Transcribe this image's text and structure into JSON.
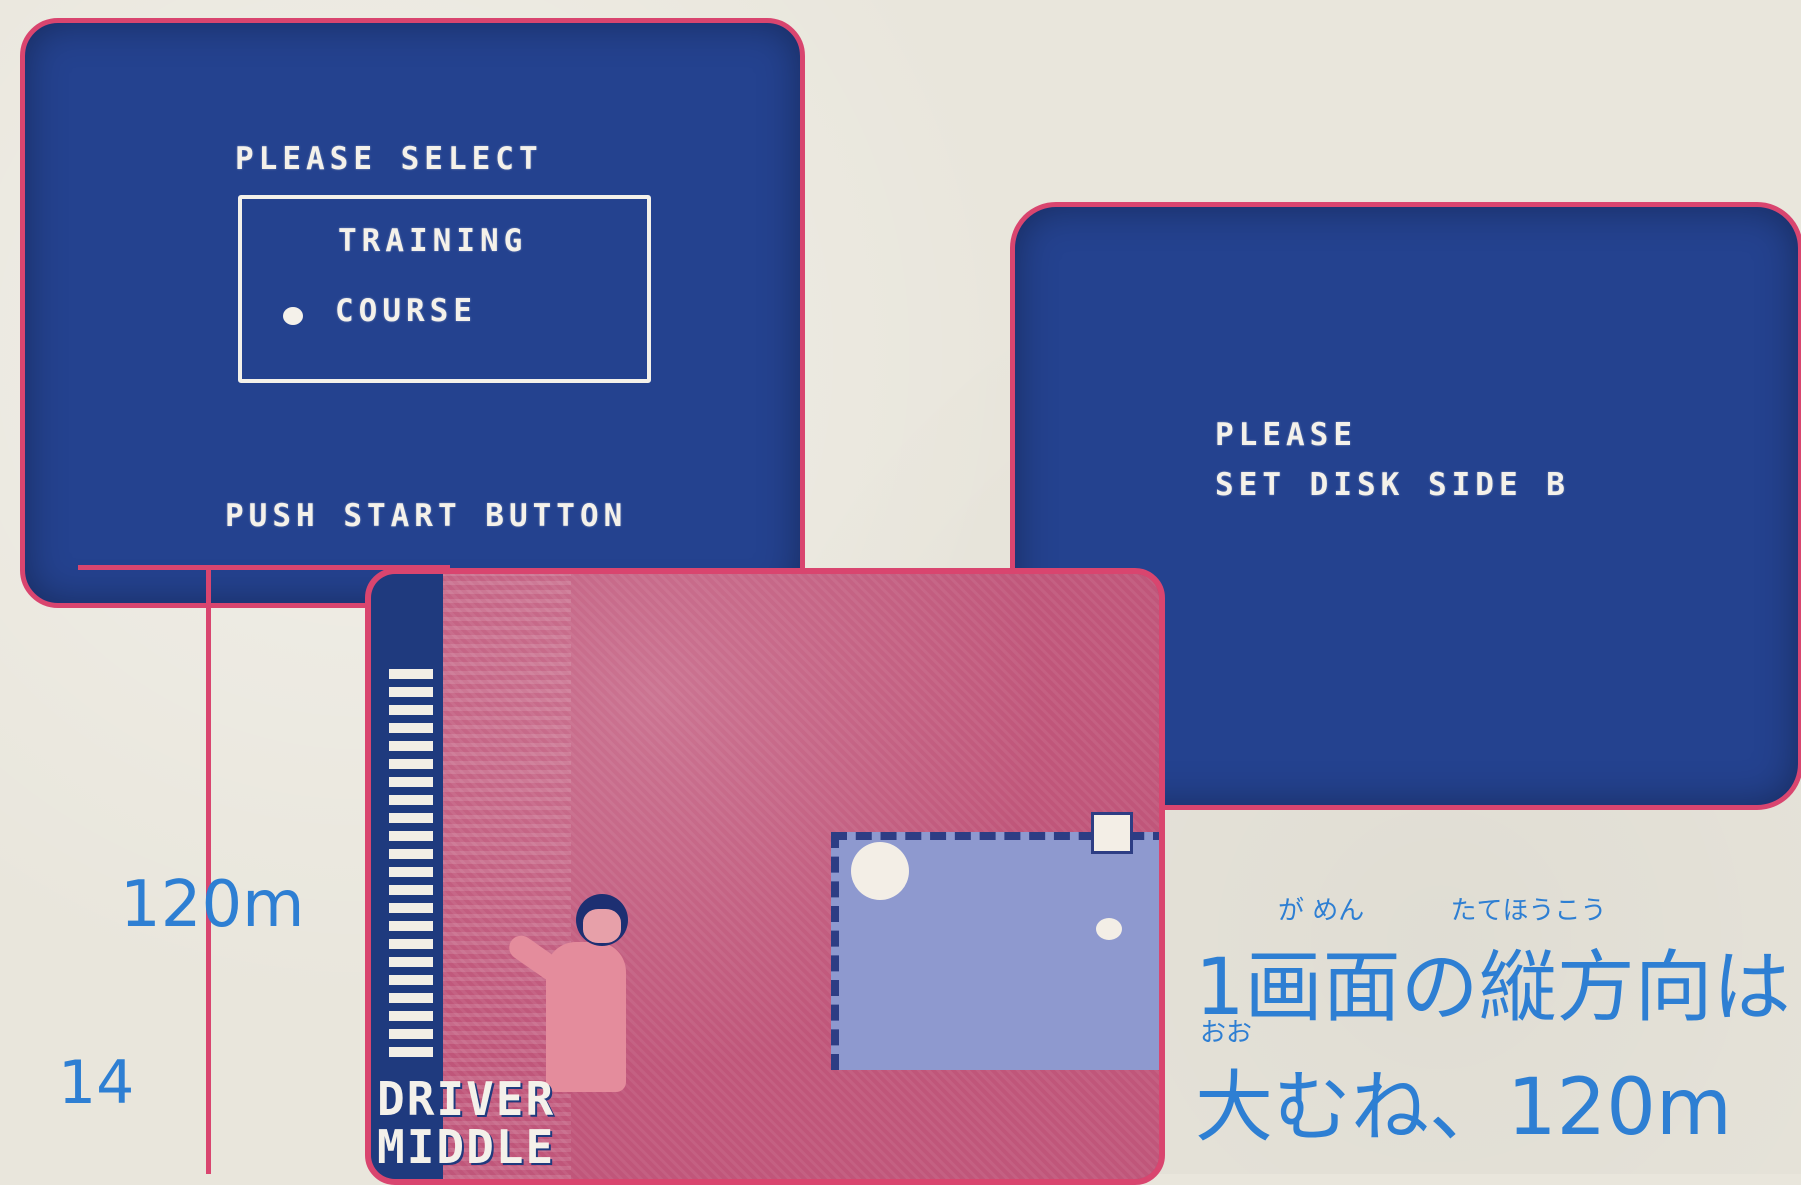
{
  "menu_screen": {
    "heading": "PLEASE SELECT",
    "options": [
      {
        "label": "TRAINING",
        "selected": false
      },
      {
        "label": "COURSE",
        "selected": true
      }
    ],
    "prompt": "PUSH START BUTTON"
  },
  "disk_screen": {
    "line1": "PLEASE",
    "line2": "SET DISK SIDE B"
  },
  "game_screen": {
    "club": "DRIVER",
    "shot": "MIDDLE",
    "power_segments": 22
  },
  "annotation": {
    "distance_label": "120m",
    "page_number": "14",
    "caption_furigana_top": "が めん　　　 たてほうこう",
    "caption_line1": "1画面の縦方向は",
    "caption_furigana_bottom": "おお",
    "caption_line2": "大むね、120m"
  },
  "colors": {
    "screen_blue": "#24428f",
    "border_pink": "#d9456f",
    "annotation_blue": "#2e7fd3"
  }
}
